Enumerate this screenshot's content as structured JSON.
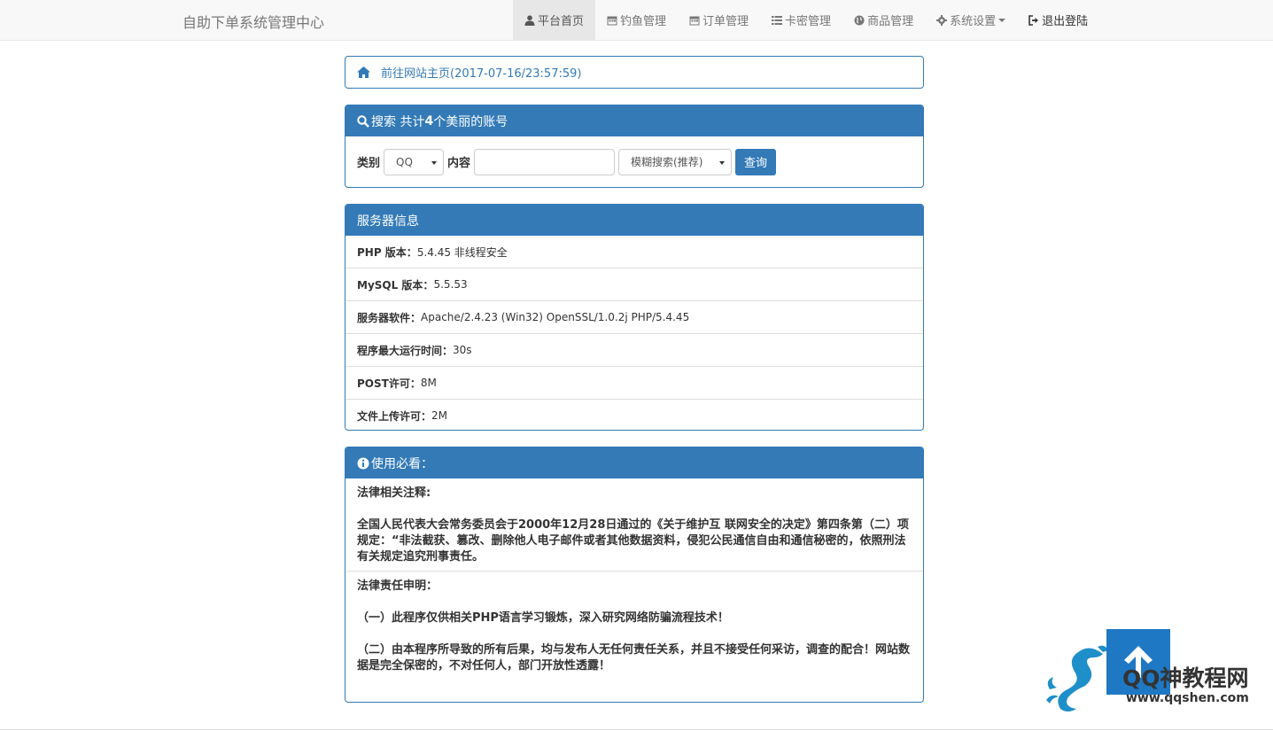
{
  "navbar": {
    "brand": "自助下单系统管理中心",
    "items": [
      {
        "label": "平台首页",
        "icon": "user-icon"
      },
      {
        "label": "钓鱼管理",
        "icon": "calendar-icon"
      },
      {
        "label": "订单管理",
        "icon": "calendar-icon"
      },
      {
        "label": "卡密管理",
        "icon": "list-icon"
      },
      {
        "label": "商品管理",
        "icon": "globe-icon"
      },
      {
        "label": "系统设置",
        "icon": "gear-icon"
      },
      {
        "label": "退出登陆",
        "icon": "logout-icon"
      }
    ]
  },
  "home_link": "前往网站主页(2017-07-16/23:57:59)",
  "search": {
    "title_prefix": "搜索 共计",
    "count": "4",
    "title_suffix": "个美丽的账号",
    "category_label": "类别",
    "category_value": "QQ",
    "content_label": "内容",
    "content_value": "",
    "mode_value": "模糊搜索(推荐)",
    "submit_label": "查询"
  },
  "server": {
    "title": "服务器信息",
    "rows": [
      {
        "key": "PHP 版本：",
        "value": "5.4.45 非线程安全"
      },
      {
        "key": "MySQL 版本：",
        "value": "5.5.53"
      },
      {
        "key": "服务器软件：",
        "value": "Apache/2.4.23 (Win32) OpenSSL/1.0.2j PHP/5.4.45"
      },
      {
        "key": "程序最大运行时间：",
        "value": "30s"
      },
      {
        "key": "POST许可：",
        "value": "8M"
      },
      {
        "key": "文件上传许可：",
        "value": "2M"
      }
    ]
  },
  "notice": {
    "title": "使用必看：",
    "sec1_title": "法律相关注释:",
    "sec1_body": "全国人民代表大会常务委员会于2000年12月28日通过的《关于维护互 联网安全的决定》第四条第（二）项规定：“非法截获、篡改、删除他人电子邮件或者其他数据资料，侵犯公民通信自由和通信秘密的，依照刑法有关规定追究刑事责任。",
    "sec2_title": "法律责任申明：",
    "sec2_p1": "（一）此程序仅供相关PHP语言学习锻炼，深入研究网络防骗流程技术！",
    "sec2_p2": "（二）由本程序所导致的所有后果，均与发布人无任何责任关系，并且不接受任何采访，调查的配合！网站数据是完全保密的，不对任何人，部门开放性透露！"
  },
  "watermark": {
    "name": "QQ神教程网",
    "url": "www.qqshen.com"
  },
  "colors": {
    "primary": "#337ab7",
    "navbar_bg": "#f8f8f8",
    "active_bg": "#e7e7e7"
  }
}
